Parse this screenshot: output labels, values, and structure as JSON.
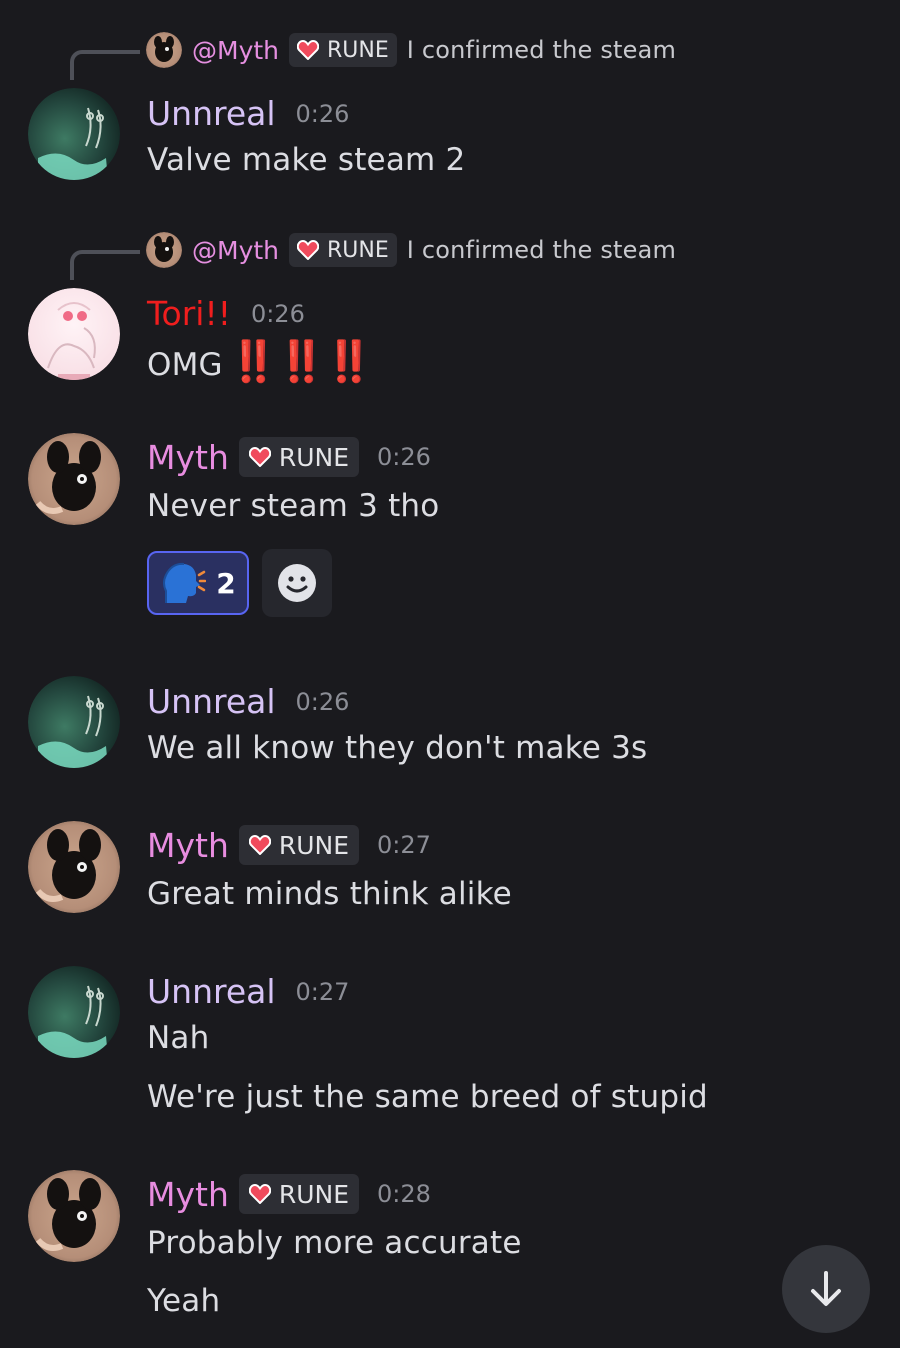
{
  "users": {
    "unreal": "Unnreal",
    "tori": "Tori!!",
    "myth": "Myth"
  },
  "tag_label": "RUNE",
  "replies": [
    {
      "mention": "@Myth",
      "tag": "RUNE",
      "text": "I confirmed the steam"
    },
    {
      "mention": "@Myth",
      "tag": "RUNE",
      "text": "I confirmed the steam"
    }
  ],
  "messages": [
    {
      "author": "Unnreal",
      "time": "0:26",
      "lines": [
        "Valve make steam 2"
      ]
    },
    {
      "author": "Tori!!",
      "time": "0:26",
      "lines": [
        "OMG"
      ],
      "emoji": "‼️‼️‼️"
    },
    {
      "author": "Myth",
      "tag": "RUNE",
      "time": "0:26",
      "lines": [
        "Never steam 3 tho"
      ]
    },
    {
      "author": "Unnreal",
      "time": "0:26",
      "lines": [
        "We all know they don't make 3s"
      ]
    },
    {
      "author": "Myth",
      "tag": "RUNE",
      "time": "0:27",
      "lines": [
        "Great minds think alike"
      ]
    },
    {
      "author": "Unnreal",
      "time": "0:27",
      "lines": [
        "Nah",
        "We're just the same breed of stupid"
      ]
    },
    {
      "author": "Myth",
      "tag": "RUNE",
      "time": "0:28",
      "lines": [
        "Probably more accurate",
        "Yeah"
      ]
    }
  ],
  "reaction": {
    "emoji": "speaking-head",
    "count": "2",
    "selected": true
  },
  "add_reaction_icon": "smiley-icon",
  "jump_button_icon": "arrow-down-icon",
  "colors": {
    "background": "#1a1a1e",
    "unreal_name": "#d6c3f5",
    "tori_name": "#f01e1e",
    "myth_name": "#e88de0",
    "timestamp": "#8c8e96",
    "reaction_bg": "#2a3061",
    "reaction_border": "#5865f2"
  }
}
